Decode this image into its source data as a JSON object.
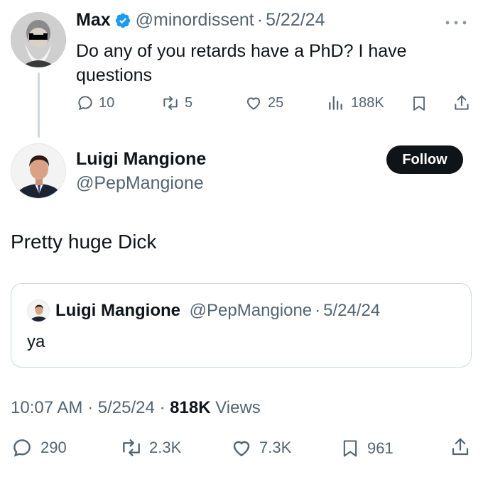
{
  "parent": {
    "name": "Max",
    "handle": "@minordissent",
    "sep": "·",
    "date": "5/22/24",
    "text": "Do any of you retards have a PhD? I have questions",
    "actions": {
      "replies": "10",
      "reposts": "5",
      "likes": "25",
      "views": "188K"
    },
    "more_icon": "ellipsis-icon",
    "colors": {
      "verified": "#1d9bf0"
    }
  },
  "reply": {
    "name": "Luigi Mangione",
    "handle": "@PepMangione",
    "follow_label": "Follow",
    "text": "Pretty huge Dick",
    "quote": {
      "name": "Luigi Mangione",
      "handle": "@PepMangione",
      "sep": "·",
      "date": "5/24/24",
      "text": "ya"
    },
    "meta": {
      "time": "10:07 AM",
      "sep1": "·",
      "date": "5/25/24",
      "sep2": "·",
      "views_count": "818K",
      "views_label": "Views"
    },
    "actions": {
      "replies": "290",
      "reposts": "2.3K",
      "likes": "7.3K",
      "bookmarks": "961"
    }
  }
}
